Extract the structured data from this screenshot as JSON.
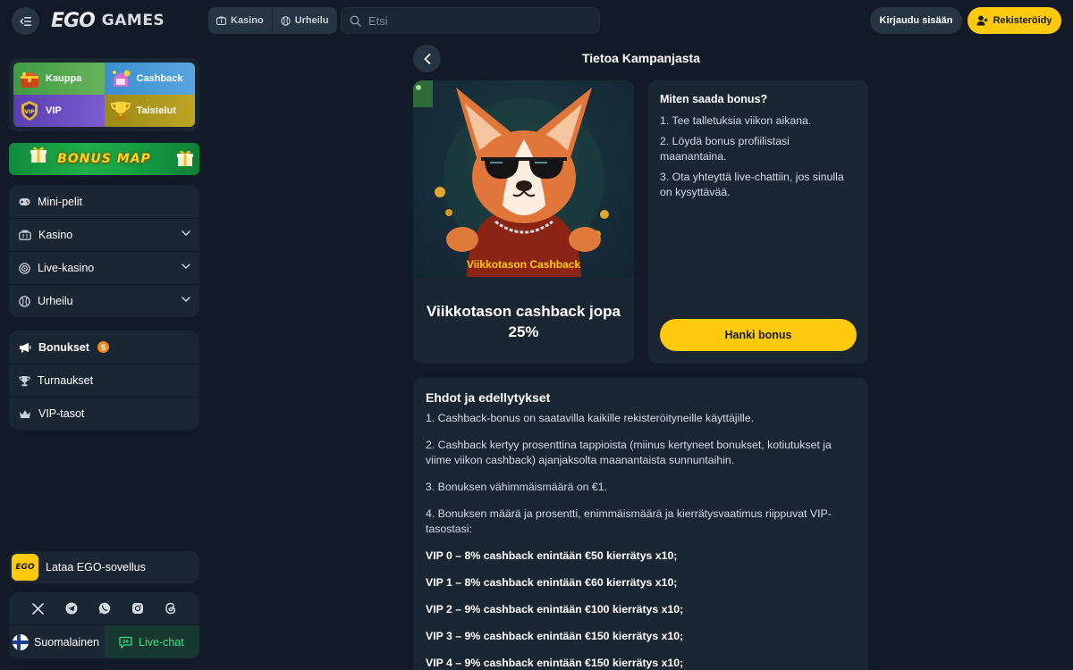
{
  "header": {
    "logo_ego": "EGO",
    "logo_games": "GAMES",
    "tabs": [
      {
        "label": "Kasino",
        "icon": "casino-icon"
      },
      {
        "label": "Urheilu",
        "icon": "sports-icon"
      }
    ],
    "search_placeholder": "Etsi",
    "login_label": "Kirjaudu sisään",
    "register_label": "Rekisteröidy"
  },
  "sidebar": {
    "promos": [
      {
        "label": "Kauppa",
        "icon": "treasure-chest-icon"
      },
      {
        "label": "Cashback",
        "icon": "cashback-icon"
      },
      {
        "label": "VIP",
        "icon": "vip-shield-icon"
      },
      {
        "label": "Taistelut",
        "icon": "trophy-icon"
      }
    ],
    "bonus_map_label": "BONUS MAP",
    "games_nav": [
      {
        "label": "Mini-pelit",
        "icon": "gamepad-icon"
      },
      {
        "label": "Kasino",
        "icon": "casino-icon"
      },
      {
        "label": "Live-kasino",
        "icon": "live-casino-icon"
      },
      {
        "label": "Urheilu",
        "icon": "sports-icon"
      }
    ],
    "extras_nav": [
      {
        "label": "Bonukset",
        "icon": "megaphone-icon",
        "badge": "5"
      },
      {
        "label": "Turnaukset",
        "icon": "trophy-icon"
      },
      {
        "label": "VIP-tasot",
        "icon": "crown-icon"
      }
    ],
    "app_logo": "EGO",
    "app_label": "Lataa EGO-sovellus",
    "socials": [
      "x-icon",
      "telegram-icon",
      "whatsapp-icon",
      "instagram-icon",
      "threads-icon"
    ],
    "language_label": "Suomalainen",
    "chat_label": "Live-chat"
  },
  "main": {
    "page_title": "Tietoa Kampanjasta",
    "promo_tag": "Viikkotason Cashback",
    "promo_headline": "Viikkotason cashback jopa 25%",
    "how_title": "Miten saada bonus?",
    "how_steps": [
      "1. Tee talletuksia viikon aikana.",
      "2. Löydä bonus profiilistasi maanantaina.",
      "3. Ota yhteyttä live-chattiin, jos sinulla on kysyttävää."
    ],
    "claim_label": "Hanki bonus",
    "terms_title": "Ehdot ja edellytykset",
    "terms": [
      "1. Cashback-bonus on saatavilla kaikille rekisteröityneille käyttäjille.",
      "2. Cashback kertyy prosenttina tappioista (miinus kertyneet bonukset, kotiutukset ja viime viikon cashback) ajanjaksolta maanantaista sunnuntaihin.",
      "3. Bonuksen vähimmäismäärä on €1.",
      "4. Bonuksen määrä ja prosentti, enimmäismäärä ja kierrätysvaatimus riippuvat VIP-tasostasi:"
    ],
    "vip_terms": [
      "VIP 0 – 8% cashback enintään €50 kierrätys x10;",
      "VIP 1 – 8% cashback enintään €60 kierrätys x10;",
      "VIP 2 – 9% cashback enintään €100 kierrätys x10;",
      "VIP 3 – 9% cashback enintään €150 kierrätys x10;",
      "VIP 4 – 9% cashback enintään €150 kierrätys x10;"
    ]
  },
  "colors": {
    "background": "#111a26",
    "panel": "#1b2633",
    "accent_yellow": "#ffc90e",
    "chat_green": "#3ce08a",
    "badge_orange": "#f08c1c"
  }
}
